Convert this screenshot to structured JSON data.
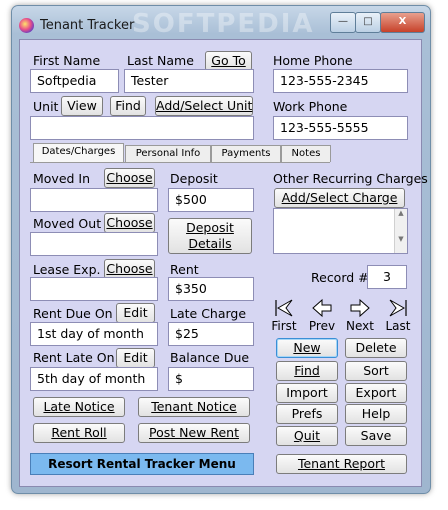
{
  "window": {
    "title": "Tenant Tracker",
    "watermark": "SOFTPEDIA",
    "minimize": "—",
    "maximize": "□",
    "close": "X"
  },
  "labels": {
    "first_name": "First Name",
    "last_name": "Last Name",
    "home_phone": "Home Phone",
    "unit": "Unit",
    "work_phone": "Work Phone",
    "moved_in": "Moved In",
    "deposit": "Deposit",
    "other_recurring": "Other Recurring Charges",
    "moved_out": "Moved Out",
    "lease_exp": "Lease Exp.",
    "rent": "Rent",
    "record": "Record #",
    "rent_due_on": "Rent Due On",
    "late_charge": "Late Charge",
    "rent_late_on": "Rent Late On",
    "balance_due": "Balance Due"
  },
  "fields": {
    "first_name": "Softpedia",
    "last_name": "Tester",
    "home_phone": "123-555-2345",
    "unit": "",
    "work_phone": "123-555-5555",
    "moved_in": "",
    "deposit": "$500",
    "moved_out": "",
    "lease_exp": "",
    "rent": "$350",
    "record": "3",
    "rent_due_on": "1st day of month",
    "late_charge": "$25",
    "rent_late_on": "5th day of month",
    "balance_due": "$"
  },
  "buttons": {
    "go_to": "Go To",
    "view": "View",
    "find_unit": "Find",
    "add_select_unit": "Add/Select Unit",
    "choose_in": "Choose",
    "choose_out": "Choose",
    "choose_lease": "Choose",
    "deposit_details_1": "Deposit",
    "deposit_details_2": "Details",
    "add_select_charge": "Add/Select Charge",
    "edit_due": "Edit",
    "edit_late": "Edit",
    "new": "New",
    "delete": "Delete",
    "find": "Find",
    "sort": "Sort",
    "import": "Import",
    "export": "Export",
    "prefs": "Prefs",
    "help": "Help",
    "quit": "Quit",
    "save": "Save",
    "late_notice": "Late Notice",
    "tenant_notice": "Tenant Notice",
    "rent_roll": "Rent Roll",
    "post_new_rent": "Post New Rent",
    "resort_menu": "Resort Rental Tracker Menu",
    "tenant_report": "Tenant Report"
  },
  "tabs": [
    "Dates/Charges",
    "Personal Info",
    "Payments",
    "Notes"
  ],
  "nav": {
    "first": "First",
    "prev": "Prev",
    "next": "Next",
    "last": "Last"
  },
  "colors": {
    "client_bg": "#d6d6f2",
    "resort_button": "#7bb9ef"
  }
}
